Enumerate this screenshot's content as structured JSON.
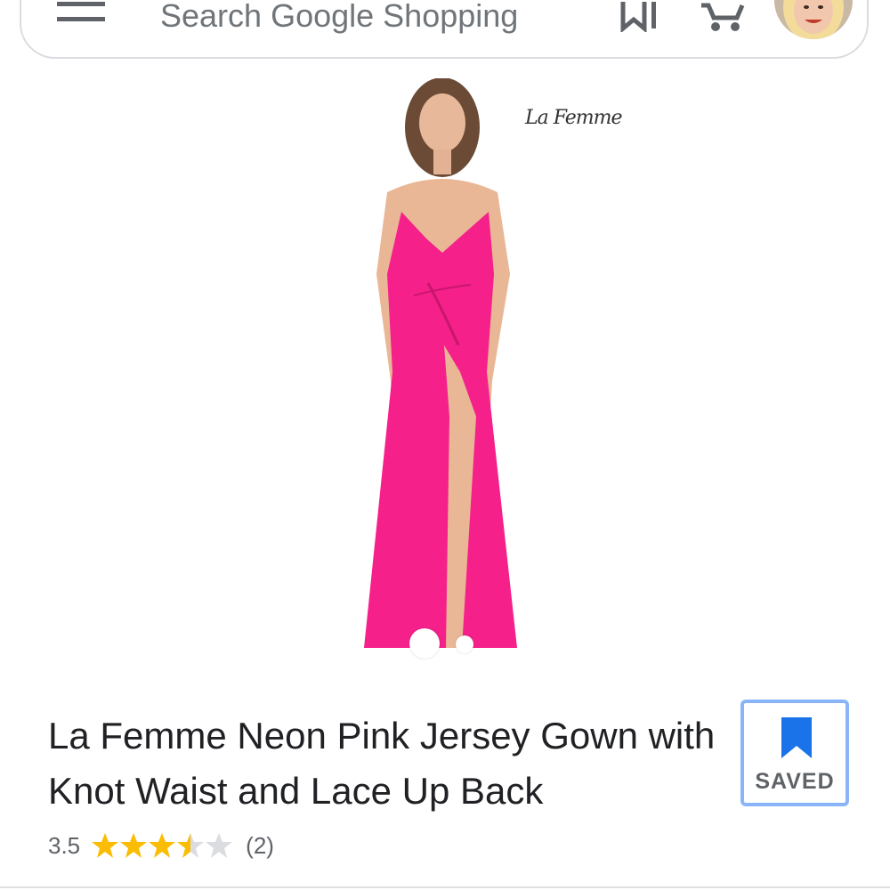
{
  "header": {
    "search_placeholder": "Search Google Shopping",
    "icons": [
      "menu-icon",
      "bookmark-icon",
      "cart-icon",
      "avatar"
    ]
  },
  "product": {
    "brand_logo": "La Femme",
    "title": "La Femme Neon Pink Jersey Gown with Knot Waist and Lace Up Back",
    "rating_value": "3.5",
    "rating": 3.5,
    "rating_max": 5,
    "review_count": "(2)",
    "image_index": 1,
    "image_count": 2
  },
  "save_button": {
    "label": "SAVED"
  },
  "colors": {
    "accent_blue": "#1a73e8",
    "border_blue": "#8ab4f8",
    "star_gold": "#fbbc04",
    "star_empty": "#dadce0",
    "dress_pink": "#f5208a"
  }
}
